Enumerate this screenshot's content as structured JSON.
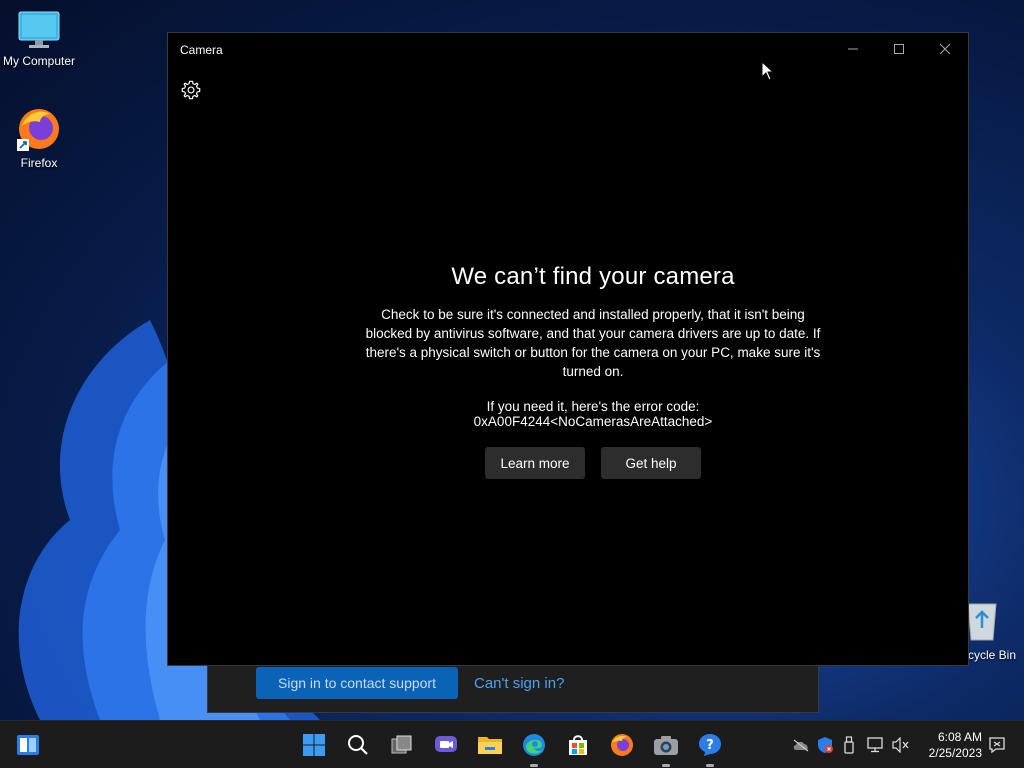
{
  "desktop": {
    "icons": [
      {
        "label": "My Computer",
        "icon": "monitor-icon"
      },
      {
        "label": "Firefox",
        "icon": "firefox-icon"
      }
    ],
    "recycle_bin_label": "cycle Bin"
  },
  "support_window": {
    "signin_label": "Sign in to contact support",
    "cant_signin_label": "Can't sign in?"
  },
  "camera_window": {
    "title": "Camera",
    "controls": {
      "minimize": "minimize-icon",
      "maximize": "maximize-icon",
      "close": "close-icon"
    },
    "settings_icon": "gear-icon",
    "error": {
      "title": "We can’t find your camera",
      "body": "Check to be sure it's connected and installed properly, that it isn't being blocked by antivirus software, and that your camera drivers are up to date. If there's a physical switch or button for the camera on your PC, make sure it's turned on.",
      "code_label": "If you need it, here's the error code:",
      "code": "0xA00F4244<NoCamerasAreAttached>",
      "learn_more": "Learn more",
      "get_help": "Get help"
    }
  },
  "taskbar": {
    "items": [
      "widgets-icon",
      "start-icon",
      "search-icon",
      "task-view-icon",
      "chat-icon",
      "file-explorer-icon",
      "edge-icon",
      "store-icon",
      "firefox-icon",
      "camera-icon",
      "get-help-icon"
    ],
    "tray": [
      "onedrive-icon",
      "defender-icon",
      "usb-icon",
      "network-icon",
      "volume-muted-icon"
    ],
    "time": "6:08 AM",
    "date": "2/25/2023",
    "notification_icon": "notification-icon"
  },
  "colors": {
    "accent": "#0a63b7",
    "link": "#4aa3ef",
    "button_bg": "#2d2d2d",
    "window_bg": "#000000"
  }
}
